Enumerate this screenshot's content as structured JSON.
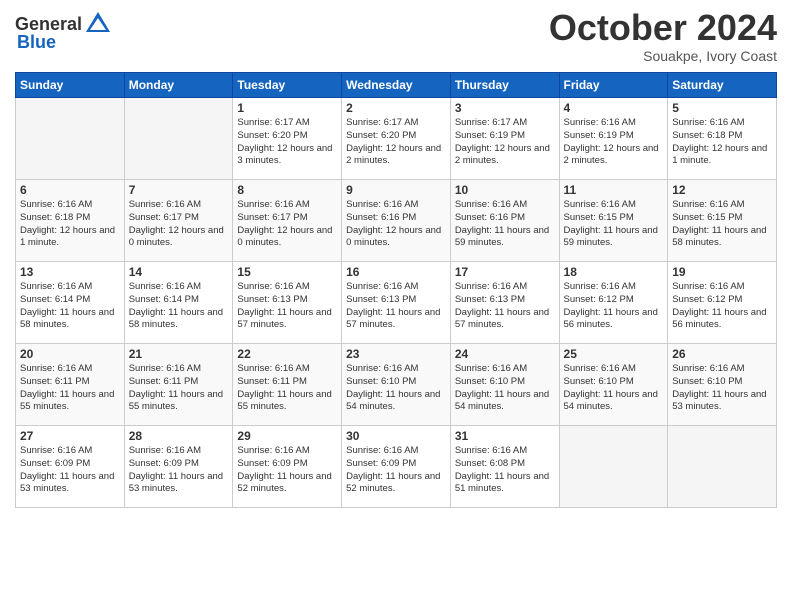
{
  "header": {
    "logo_general": "General",
    "logo_blue": "Blue",
    "month": "October 2024",
    "location": "Souakpe, Ivory Coast"
  },
  "weekdays": [
    "Sunday",
    "Monday",
    "Tuesday",
    "Wednesday",
    "Thursday",
    "Friday",
    "Saturday"
  ],
  "weeks": [
    [
      {
        "day": "",
        "info": ""
      },
      {
        "day": "",
        "info": ""
      },
      {
        "day": "1",
        "info": "Sunrise: 6:17 AM\nSunset: 6:20 PM\nDaylight: 12 hours and 3 minutes."
      },
      {
        "day": "2",
        "info": "Sunrise: 6:17 AM\nSunset: 6:20 PM\nDaylight: 12 hours and 2 minutes."
      },
      {
        "day": "3",
        "info": "Sunrise: 6:17 AM\nSunset: 6:19 PM\nDaylight: 12 hours and 2 minutes."
      },
      {
        "day": "4",
        "info": "Sunrise: 6:16 AM\nSunset: 6:19 PM\nDaylight: 12 hours and 2 minutes."
      },
      {
        "day": "5",
        "info": "Sunrise: 6:16 AM\nSunset: 6:18 PM\nDaylight: 12 hours and 1 minute."
      }
    ],
    [
      {
        "day": "6",
        "info": "Sunrise: 6:16 AM\nSunset: 6:18 PM\nDaylight: 12 hours and 1 minute."
      },
      {
        "day": "7",
        "info": "Sunrise: 6:16 AM\nSunset: 6:17 PM\nDaylight: 12 hours and 0 minutes."
      },
      {
        "day": "8",
        "info": "Sunrise: 6:16 AM\nSunset: 6:17 PM\nDaylight: 12 hours and 0 minutes."
      },
      {
        "day": "9",
        "info": "Sunrise: 6:16 AM\nSunset: 6:16 PM\nDaylight: 12 hours and 0 minutes."
      },
      {
        "day": "10",
        "info": "Sunrise: 6:16 AM\nSunset: 6:16 PM\nDaylight: 11 hours and 59 minutes."
      },
      {
        "day": "11",
        "info": "Sunrise: 6:16 AM\nSunset: 6:15 PM\nDaylight: 11 hours and 59 minutes."
      },
      {
        "day": "12",
        "info": "Sunrise: 6:16 AM\nSunset: 6:15 PM\nDaylight: 11 hours and 58 minutes."
      }
    ],
    [
      {
        "day": "13",
        "info": "Sunrise: 6:16 AM\nSunset: 6:14 PM\nDaylight: 11 hours and 58 minutes."
      },
      {
        "day": "14",
        "info": "Sunrise: 6:16 AM\nSunset: 6:14 PM\nDaylight: 11 hours and 58 minutes."
      },
      {
        "day": "15",
        "info": "Sunrise: 6:16 AM\nSunset: 6:13 PM\nDaylight: 11 hours and 57 minutes."
      },
      {
        "day": "16",
        "info": "Sunrise: 6:16 AM\nSunset: 6:13 PM\nDaylight: 11 hours and 57 minutes."
      },
      {
        "day": "17",
        "info": "Sunrise: 6:16 AM\nSunset: 6:13 PM\nDaylight: 11 hours and 57 minutes."
      },
      {
        "day": "18",
        "info": "Sunrise: 6:16 AM\nSunset: 6:12 PM\nDaylight: 11 hours and 56 minutes."
      },
      {
        "day": "19",
        "info": "Sunrise: 6:16 AM\nSunset: 6:12 PM\nDaylight: 11 hours and 56 minutes."
      }
    ],
    [
      {
        "day": "20",
        "info": "Sunrise: 6:16 AM\nSunset: 6:11 PM\nDaylight: 11 hours and 55 minutes."
      },
      {
        "day": "21",
        "info": "Sunrise: 6:16 AM\nSunset: 6:11 PM\nDaylight: 11 hours and 55 minutes."
      },
      {
        "day": "22",
        "info": "Sunrise: 6:16 AM\nSunset: 6:11 PM\nDaylight: 11 hours and 55 minutes."
      },
      {
        "day": "23",
        "info": "Sunrise: 6:16 AM\nSunset: 6:10 PM\nDaylight: 11 hours and 54 minutes."
      },
      {
        "day": "24",
        "info": "Sunrise: 6:16 AM\nSunset: 6:10 PM\nDaylight: 11 hours and 54 minutes."
      },
      {
        "day": "25",
        "info": "Sunrise: 6:16 AM\nSunset: 6:10 PM\nDaylight: 11 hours and 54 minutes."
      },
      {
        "day": "26",
        "info": "Sunrise: 6:16 AM\nSunset: 6:10 PM\nDaylight: 11 hours and 53 minutes."
      }
    ],
    [
      {
        "day": "27",
        "info": "Sunrise: 6:16 AM\nSunset: 6:09 PM\nDaylight: 11 hours and 53 minutes."
      },
      {
        "day": "28",
        "info": "Sunrise: 6:16 AM\nSunset: 6:09 PM\nDaylight: 11 hours and 53 minutes."
      },
      {
        "day": "29",
        "info": "Sunrise: 6:16 AM\nSunset: 6:09 PM\nDaylight: 11 hours and 52 minutes."
      },
      {
        "day": "30",
        "info": "Sunrise: 6:16 AM\nSunset: 6:09 PM\nDaylight: 11 hours and 52 minutes."
      },
      {
        "day": "31",
        "info": "Sunrise: 6:16 AM\nSunset: 6:08 PM\nDaylight: 11 hours and 51 minutes."
      },
      {
        "day": "",
        "info": ""
      },
      {
        "day": "",
        "info": ""
      }
    ]
  ]
}
